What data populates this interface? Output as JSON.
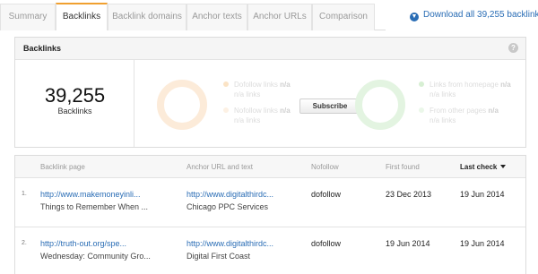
{
  "tabs": [
    {
      "label": "Summary",
      "active": false
    },
    {
      "label": "Backlinks",
      "active": true
    },
    {
      "label": "Backlink domains",
      "active": false
    },
    {
      "label": "Anchor texts",
      "active": false
    },
    {
      "label": "Anchor URLs",
      "active": false
    },
    {
      "label": "Comparison",
      "active": false
    }
  ],
  "download": {
    "label": "Download all 39,255 backlinks",
    "icon": "download-circle-icon"
  },
  "panel": {
    "title": "Backlinks",
    "help_icon": "?",
    "count": "39,255",
    "count_label": "Backlinks",
    "left_legend": [
      {
        "label": "Dofollow links",
        "value": "n/a",
        "sub": "n/a links"
      },
      {
        "label": "Nofollow links",
        "value": "n/a",
        "sub": "n/a links"
      }
    ],
    "right_legend": [
      {
        "label": "Links from homepage",
        "value": "n/a",
        "sub": "n/a links"
      },
      {
        "label": "From other pages",
        "value": "n/a",
        "sub": "n/a links"
      }
    ],
    "subscribe_label": "Subscribe",
    "colors": {
      "orange": "#fcebd9",
      "green": "#e3f4e1"
    }
  },
  "table": {
    "headers": {
      "backlink_page": "Backlink page",
      "anchor": "Anchor URL and text",
      "nofollow": "Nofollow",
      "first_found": "First found",
      "last_check": "Last check"
    },
    "rows": [
      {
        "index": "1.",
        "page_url": "http://www.makemoneyinli...",
        "page_title": "Things to Remember When ...",
        "anchor_url": "http://www.digitalthirdc...",
        "anchor_text": "Chicago PPC Services",
        "nofollow": "dofollow",
        "first_found": "23 Dec 2013",
        "last_check": "19 Jun 2014"
      },
      {
        "index": "2.",
        "page_url": "http://truth-out.org/spe...",
        "page_title": "Wednesday: Community Gro...",
        "anchor_url": "http://www.digitalthirdc...",
        "anchor_text": "Digital First Coast",
        "nofollow": "dofollow",
        "first_found": "19 Jun 2014",
        "last_check": "19 Jun 2014"
      }
    ]
  }
}
